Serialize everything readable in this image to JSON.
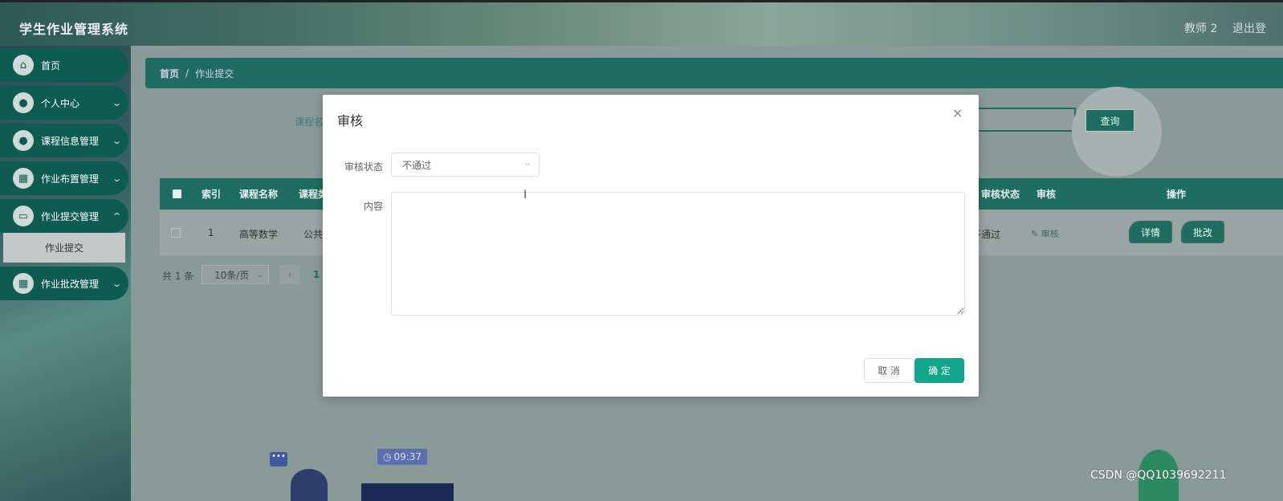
{
  "header": {
    "app_title": "学生作业管理系统",
    "user_name": "教师 2",
    "logout_label": "退出登"
  },
  "sidebar": {
    "items": [
      {
        "label": "首页",
        "icon": "home-icon"
      },
      {
        "label": "个人中心",
        "icon": "user-icon"
      },
      {
        "label": "课程信息管理",
        "icon": "user-icon"
      },
      {
        "label": "作业布置管理",
        "icon": "grid-icon"
      },
      {
        "label": "作业提交管理",
        "icon": "monitor-icon"
      },
      {
        "label": "作业批改管理",
        "icon": "grid-icon"
      }
    ],
    "submenu_active": "作业提交"
  },
  "breadcrumb": {
    "home": "首页",
    "separator": "/",
    "current": "作业提交"
  },
  "search": {
    "course_label": "课程名",
    "query_label": "查询"
  },
  "table": {
    "headers": {
      "index": "索引",
      "course_name": "课程名称",
      "course_type": "课程类",
      "audit_status": "审核状态",
      "audit": "审核",
      "actions": "操作"
    },
    "rows": [
      {
        "index": "1",
        "course_name": "高等数学",
        "course_type": "公共",
        "audit_status": "不通过",
        "audit_link": "审核",
        "detail_btn": "详情",
        "grade_btn": "批改"
      }
    ]
  },
  "pagination": {
    "total": "共 1 条",
    "page_size": "10条/页",
    "current_page": "1"
  },
  "decor": {
    "time": "09:37"
  },
  "dialog": {
    "title": "审核",
    "status_label": "审核状态",
    "status_value": "不通过",
    "content_label": "内容",
    "content_value": "",
    "cancel_label": "取 消",
    "confirm_label": "确 定"
  },
  "watermark": "CSDN @QQ1039692211"
}
